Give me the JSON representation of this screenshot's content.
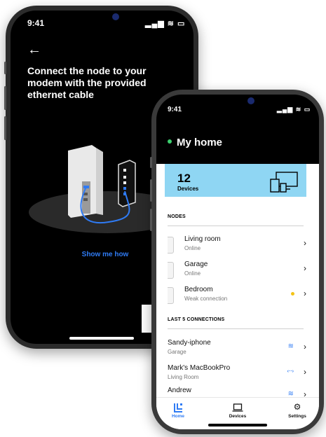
{
  "status": {
    "time": "9:41",
    "icons": "▂▄▆ ≋ ▭"
  },
  "setup": {
    "back": "←",
    "title": "Connect the node to your modem with the provided ethernet cable",
    "show_link": "Show me how",
    "next": "→"
  },
  "home": {
    "title": "My home",
    "devices_count": "12",
    "devices_label": "Devices",
    "nodes_header": "NODES",
    "nodes": [
      {
        "name": "Living room",
        "status": "Online"
      },
      {
        "name": "Garage",
        "status": "Online"
      },
      {
        "name": "Bedroom",
        "status": "Weak connection"
      }
    ],
    "connections_header": "LAST 5 CONNECTIONS",
    "connections": [
      {
        "name": "Sandy-iphone",
        "location": "Garage",
        "type": "wifi"
      },
      {
        "name": "Mark's MacBookPro",
        "location": "Living Room",
        "type": "ethernet"
      },
      {
        "name": "Andrew",
        "location": "",
        "type": "wifi"
      }
    ],
    "chevron": "›",
    "wifi_glyph": "≋",
    "eth_glyph": "‹··›"
  },
  "tabs": [
    {
      "label": "Home",
      "icon": "home-logo-icon",
      "active": true
    },
    {
      "label": "Devices",
      "icon": "laptop-icon",
      "active": false
    },
    {
      "label": "Settings",
      "icon": "gear-icon",
      "active": false
    }
  ],
  "colors": {
    "accent": "#2f7bf4",
    "card": "#8fd6f3",
    "online": "#3ccf6e",
    "warning": "#f3c316"
  }
}
